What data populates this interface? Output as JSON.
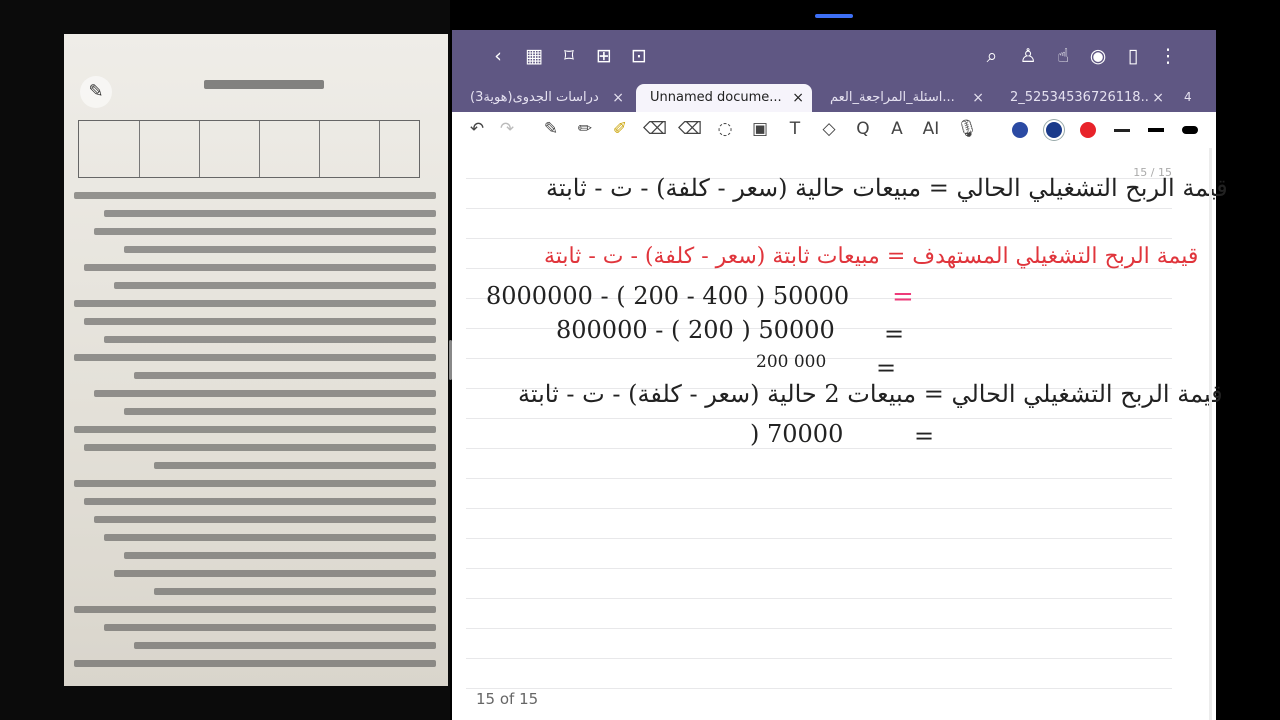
{
  "status": {
    "dot": "•"
  },
  "photo": {
    "title": "المجموعة(A)",
    "lines": [
      "س1/ الفرع(A) توفرت لديك البيانات الآتية: علماً ان الشركة تستخدم كامل طاقتها الانتاجية",
      "(A:750,000,B:740,000,C:730,000,D:720,000)",
      "(A:250,000,B:240,000,C:260,000,D:200,000)",
      "(A:%50,B:%60,C:%70,D:%65)",
      "(A:%20,B:%30,C:%25,D:%35)",
      "(A:%2,B:%3,C:%4,D:%5)",
      "(A:100,000,B:110,000,C:120,000,D:130,000)",
      "(A:1000,000,B:1100,000,C:1200,000,D:1300,000)",
      "(A:900,000,B:800,000,C:700,000,D:750,000)",
      "(A:1200,000,B:1300,000,C:1400,000,D:1500,000)",
      "(A:14,000,B:15,000,C:11,000,D:14,500)",
      "(A:2000,000,B:1500,000,C:1000,000,D:2500,000)",
      "(A: 5,000,000,B:6,000,000,C:7,000,000,D:8,000,000)",
      "(A:%200,B:%100,C:%80,D:%60)",
      "(A:2,B:3,C:4,D:5)",
      "(A:1100,000,B:1200,000,C:1300,000,D:1400,000)",
      "(A:1.25,B:1.9,C:1.75,D:2)"
    ]
  },
  "topbar": {
    "back": "‹",
    "grid": "▦",
    "bookmark": "⌑",
    "add": "⊞",
    "crop": "⊡",
    "search": "⌕",
    "shirt": "♙",
    "hand": "☝",
    "eye": "◉",
    "doc": "▯",
    "more": "⋮"
  },
  "tabs": [
    {
      "label": "دراسات الجدوى(هوية3)",
      "close": "×"
    },
    {
      "label": "Unnamed docume...",
      "close": "×"
    },
    {
      "label": "اسئلة_المراجعة_العم...",
      "close": "×"
    },
    {
      "label": "2_52534536726118...",
      "close": "×"
    }
  ],
  "tab_count": "4",
  "tools": {
    "undo": "↶",
    "redo": "↷",
    "pen": "✎",
    "pencil": "✏",
    "highlighter": "✐",
    "eraser": "⌫",
    "lasso": "◌",
    "image": "▣",
    "text": "T",
    "shapes": "◇",
    "ocr": "Q",
    "convert": "A",
    "ai": "AI",
    "mic": "🎙"
  },
  "colors": [
    "#2b4aa3",
    "#1a3a8a",
    "#e8232a",
    "#222222",
    "#000000"
  ],
  "note": {
    "page_indicator": "15 / 15",
    "page_count": "15 of 15",
    "line1": "قيمة الربح التشغيلي الحالي = مبيعات حالية (سعر - كلفة) - ت - ثابتة",
    "line2": "قيمة الربح التشغيلي المستهدف = مبيعات ثابتة (سعر - كلفة) - ت - ثابتة",
    "line3": "8000000 - ( 200 - 400 ) 50000",
    "eq3": "=",
    "line4": "800000 - ( 200 ) 50000",
    "eq4": "=",
    "line5": "200 000",
    "eq5": "=",
    "line6": "قيمة الربح التشغيلي الحالي = مبيعات 2 حالية (سعر - كلفة) - ت - ثابتة",
    "line7": ") 70000",
    "eq7": "="
  }
}
